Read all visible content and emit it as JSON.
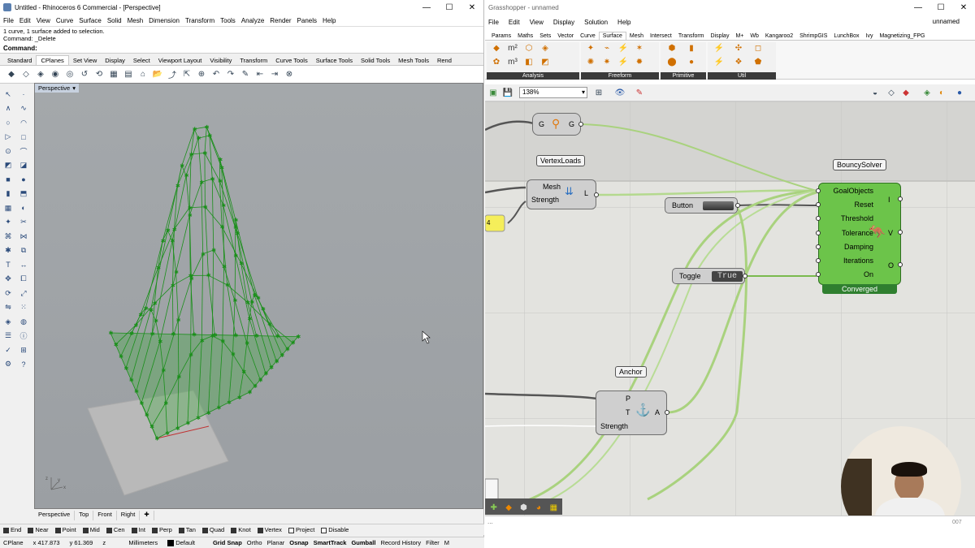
{
  "rhino": {
    "title": "Untitled - Rhinoceros 6 Commercial - [Perspective]",
    "menus": [
      "File",
      "Edit",
      "View",
      "Curve",
      "Surface",
      "Solid",
      "Mesh",
      "Dimension",
      "Transform",
      "Tools",
      "Analyze",
      "Render",
      "Panels",
      "Help"
    ],
    "history": [
      "1 curve, 1 surface added to selection.",
      "Command: _Delete"
    ],
    "command_label": "Command:",
    "toolbar_tabs": [
      "Standard",
      "CPlanes",
      "Set View",
      "Display",
      "Select",
      "Viewport Layout",
      "Visibility",
      "Transform",
      "Curve Tools",
      "Surface Tools",
      "Solid Tools",
      "Mesh Tools",
      "Rend"
    ],
    "active_tab": "CPlanes",
    "viewport_title": "Perspective",
    "viewport_tabs": [
      "Perspective",
      "Top",
      "Front",
      "Right"
    ],
    "osnaps": [
      {
        "label": "End",
        "on": true
      },
      {
        "label": "Near",
        "on": true
      },
      {
        "label": "Point",
        "on": true
      },
      {
        "label": "Mid",
        "on": true
      },
      {
        "label": "Cen",
        "on": true
      },
      {
        "label": "Int",
        "on": true
      },
      {
        "label": "Perp",
        "on": true
      },
      {
        "label": "Tan",
        "on": true
      },
      {
        "label": "Quad",
        "on": true
      },
      {
        "label": "Knot",
        "on": true
      },
      {
        "label": "Vertex",
        "on": true
      },
      {
        "label": "Project",
        "on": false
      },
      {
        "label": "Disable",
        "on": false
      }
    ],
    "status": {
      "cplane": "CPlane",
      "x": "x 417.873",
      "y": "y 61.369",
      "z": "z",
      "units": "Millimeters",
      "layer": "Default",
      "toggles": [
        "Grid Snap",
        "Ortho",
        "Planar",
        "Osnap",
        "SmartTrack",
        "Gumball",
        "Record History",
        "Filter",
        "M"
      ]
    }
  },
  "gh": {
    "title": "Grasshopper - unnamed",
    "doc_name": "unnamed",
    "menus": [
      "File",
      "Edit",
      "View",
      "Display",
      "Solution",
      "Help"
    ],
    "tabs": [
      "Params",
      "Maths",
      "Sets",
      "Vector",
      "Curve",
      "Surface",
      "Mesh",
      "Intersect",
      "Transform",
      "Display",
      "M+",
      "Wb",
      "Kangaroo2",
      "ShrimpGIS",
      "LunchBox",
      "Ivy",
      "Magnetizing_FPG"
    ],
    "active_tab": "Surface",
    "groups": [
      "Analysis",
      "Freeform",
      "Primitive",
      "Util"
    ],
    "zoom": "138%",
    "components": {
      "gate": {
        "left": "G",
        "right": "G"
      },
      "vertexloads": {
        "label": "VertexLoads",
        "inputs": [
          "Mesh",
          "Strength"
        ],
        "output": "L"
      },
      "button": {
        "label": "Button"
      },
      "toggle": {
        "label": "Toggle",
        "value": "True"
      },
      "solver": {
        "label": "BouncySolver",
        "inputs": [
          "GoalObjects",
          "Reset",
          "Threshold",
          "Tolerance",
          "Damping",
          "Iterations",
          "On"
        ],
        "outputs": [
          "I",
          "V",
          "O"
        ],
        "status": "Converged"
      },
      "anchor": {
        "label": "Anchor",
        "inputs": [
          "P",
          "T",
          "Strength"
        ],
        "output": "A"
      },
      "slider_value": "4"
    },
    "corner_number": "007"
  },
  "colors": {
    "mesh": "#1a8f1a",
    "solver_green": "#66c244",
    "wire_green": "#9dcf6a",
    "converged_bg": "#2f7f2f"
  }
}
